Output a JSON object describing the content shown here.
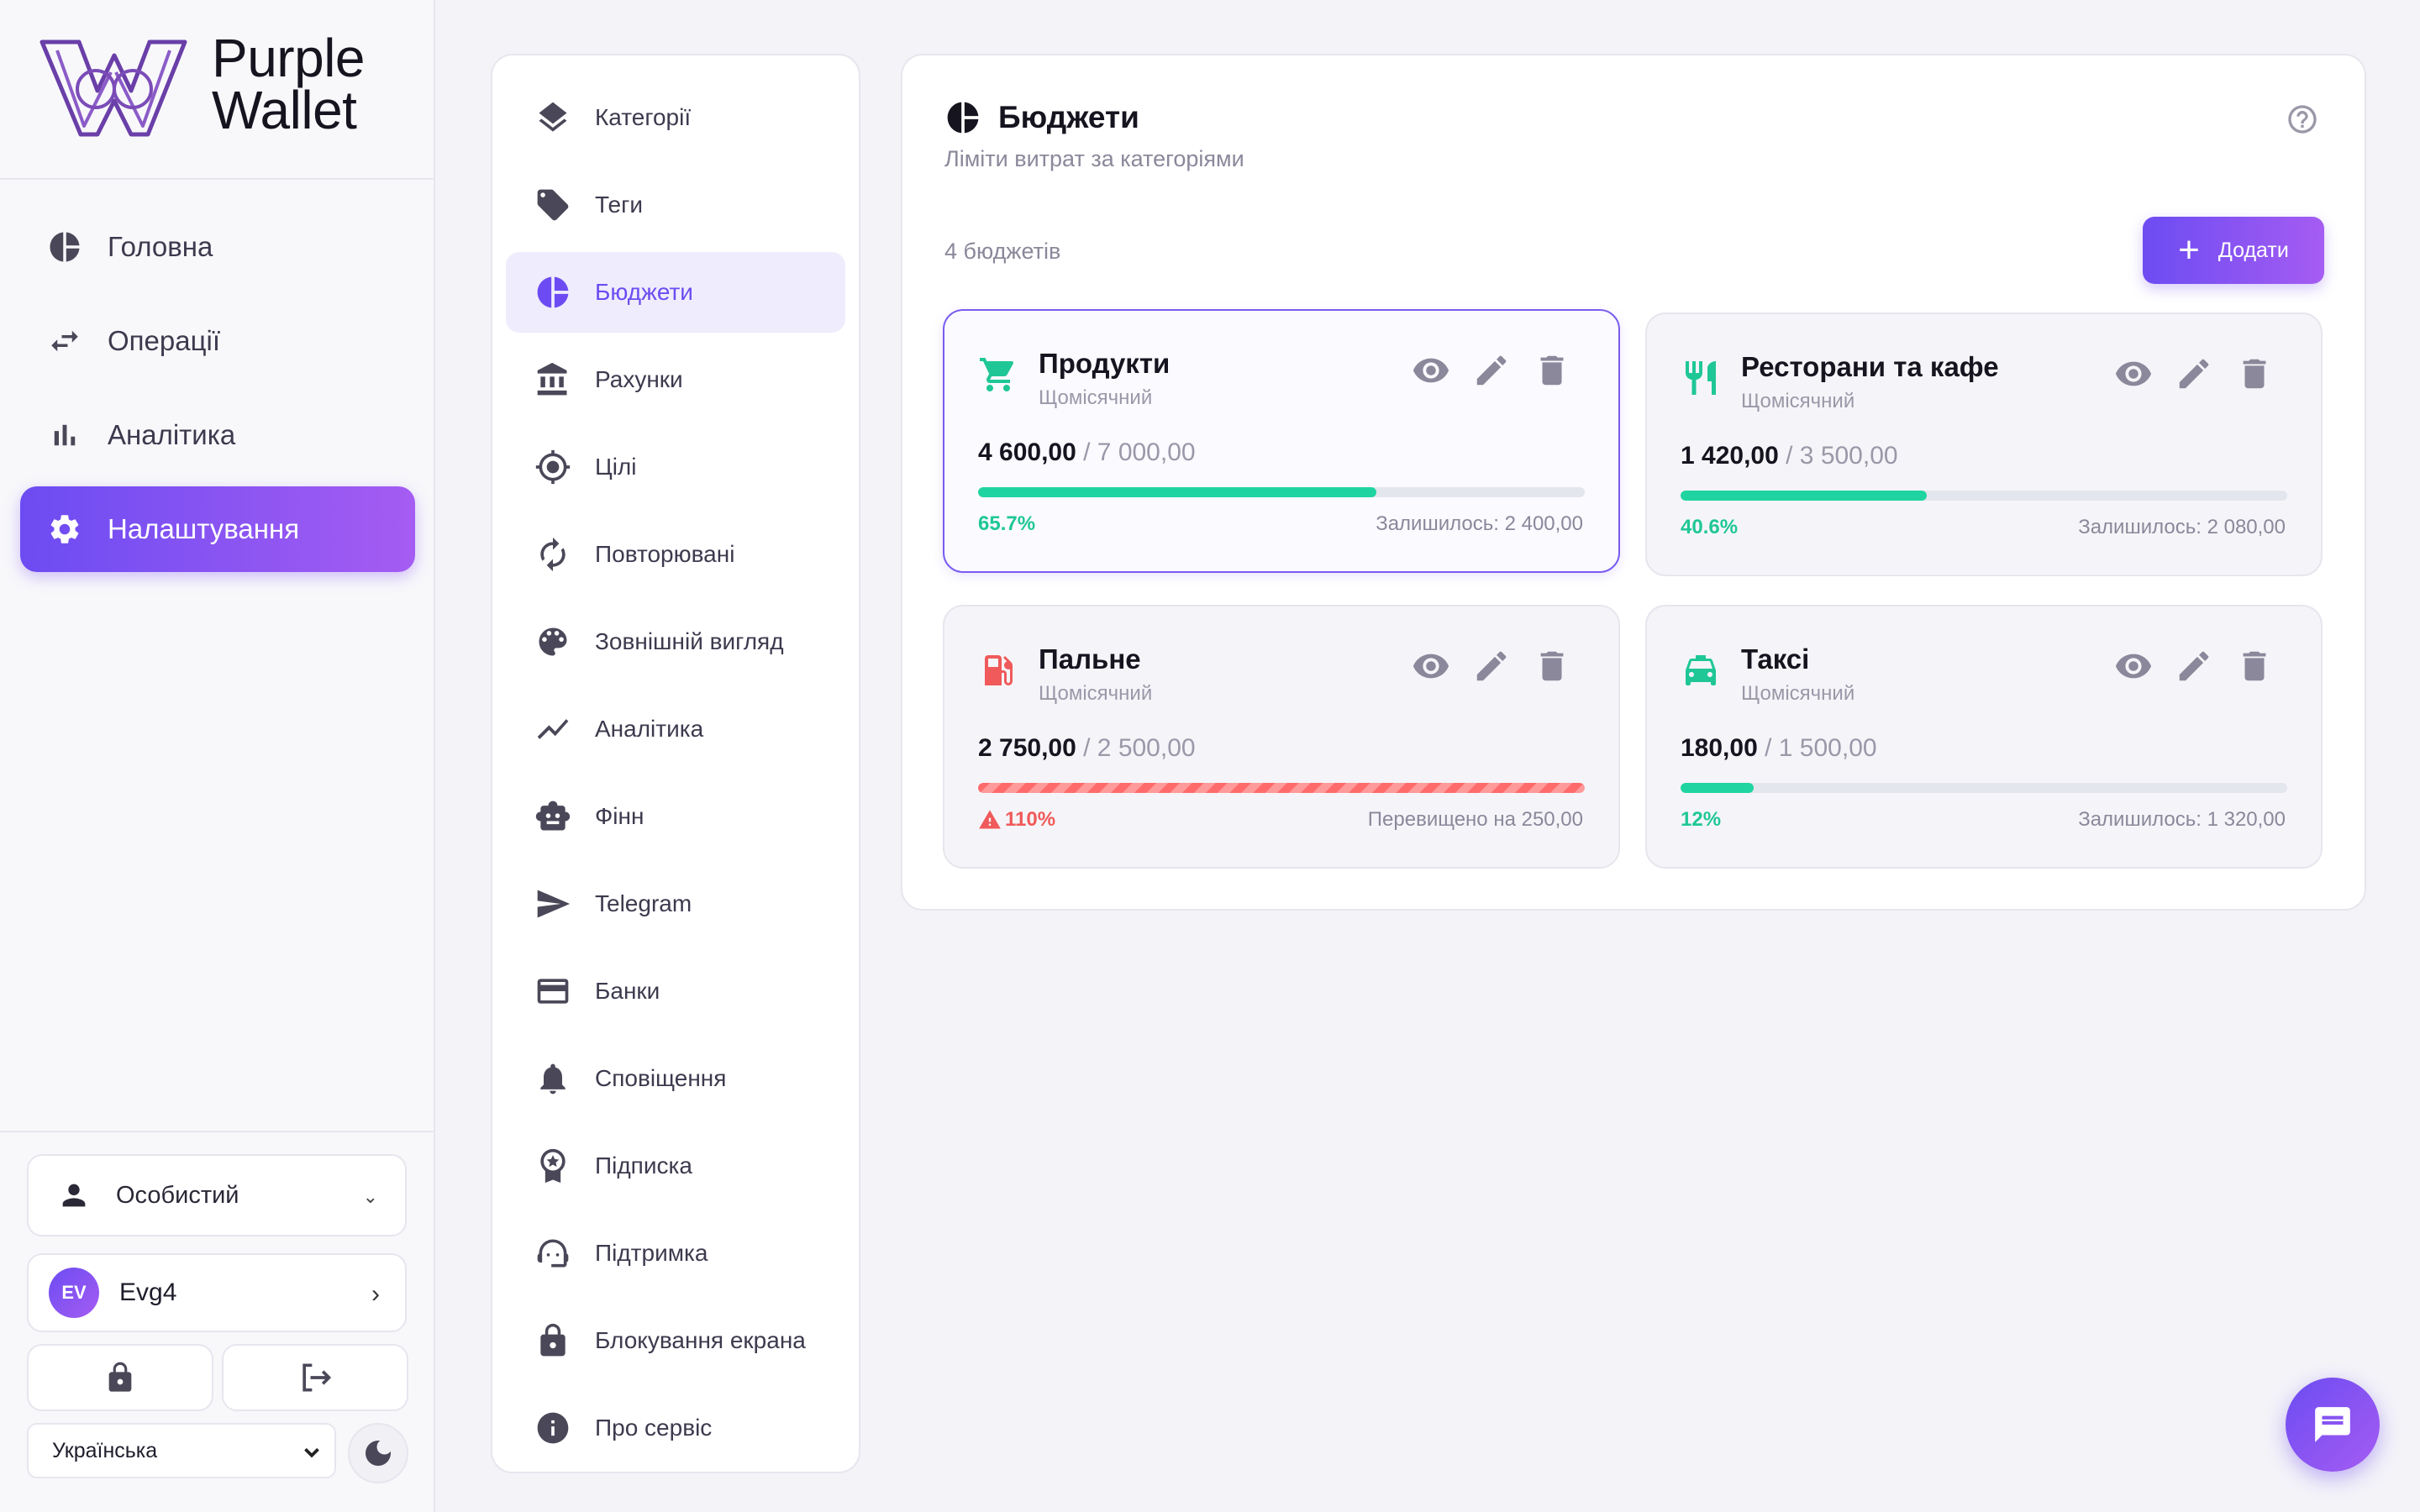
{
  "brand": {
    "line1": "Purple",
    "line2": "Wallet",
    "logo_icon": "purple-wallet-w-logo"
  },
  "main_nav": [
    {
      "label": "Головна",
      "icon": "pie-icon",
      "active": false
    },
    {
      "label": "Операції",
      "icon": "swap-arrows-icon",
      "active": false
    },
    {
      "label": "Аналітика",
      "icon": "bar-chart-icon",
      "active": false
    },
    {
      "label": "Налаштування",
      "icon": "gear-icon",
      "active": true
    }
  ],
  "workspace": {
    "label": "Особистий",
    "icon": "person-icon"
  },
  "user": {
    "initials": "EV",
    "name": "Evg4"
  },
  "language": {
    "selected": "Українська"
  },
  "settings_menu": [
    {
      "label": "Категорії",
      "icon": "layers-icon"
    },
    {
      "label": "Теги",
      "icon": "tag-icon"
    },
    {
      "label": "Бюджети",
      "icon": "pie-icon",
      "active": true
    },
    {
      "label": "Рахунки",
      "icon": "bank-icon"
    },
    {
      "label": "Цілі",
      "icon": "target-icon"
    },
    {
      "label": "Повторювані",
      "icon": "repeat-icon"
    },
    {
      "label": "Зовнішній вигляд",
      "icon": "palette-icon"
    },
    {
      "label": "Аналітика",
      "icon": "trend-icon"
    },
    {
      "label": "Фінн",
      "icon": "robot-icon"
    },
    {
      "label": "Telegram",
      "icon": "send-icon"
    },
    {
      "label": "Банки",
      "icon": "card-icon"
    },
    {
      "label": "Сповіщення",
      "icon": "bell-icon"
    },
    {
      "label": "Підписка",
      "icon": "badge-icon"
    },
    {
      "label": "Підтримка",
      "icon": "support-icon"
    },
    {
      "label": "Блокування екрана",
      "icon": "lock-icon"
    },
    {
      "label": "Про сервіс",
      "icon": "info-icon"
    }
  ],
  "budgets": {
    "title": "Бюджети",
    "subtitle": "Ліміти витрат за категоріями",
    "count_label": "4 бюджетів",
    "add_label": "Додати",
    "items": [
      {
        "name": "Продукти",
        "period": "Щомісячний",
        "spent": "4 600,00",
        "limit": "/ 7 000,00",
        "percent": "65.7%",
        "progress": 0.657,
        "status": "Залишилось: 2 400,00",
        "over": false,
        "icon": "cart-icon",
        "color": "#1fc796"
      },
      {
        "name": "Ресторани та кафе",
        "period": "Щомісячний",
        "spent": "1 420,00",
        "limit": "/ 3 500,00",
        "percent": "40.6%",
        "progress": 0.406,
        "status": "Залишилось: 2 080,00",
        "over": false,
        "icon": "cutlery-icon",
        "color": "#1fc796"
      },
      {
        "name": "Пальне",
        "period": "Щомісячний",
        "spent": "2 750,00",
        "limit": "/ 2 500,00",
        "percent": "110%",
        "progress": 1.0,
        "status": "Перевищено на 250,00",
        "over": true,
        "icon": "fuel-icon",
        "color": "#f05a5a"
      },
      {
        "name": "Таксі",
        "period": "Щомісячний",
        "spent": "180,00",
        "limit": "/ 1 500,00",
        "percent": "12%",
        "progress": 0.12,
        "status": "Залишилось: 1 320,00",
        "over": false,
        "icon": "taxi-icon",
        "color": "#1fc796"
      }
    ]
  },
  "colors": {
    "accent": "#6c4cf2",
    "accent2": "#a55cf2",
    "ok": "#1fc796",
    "danger": "#f05a5a"
  }
}
